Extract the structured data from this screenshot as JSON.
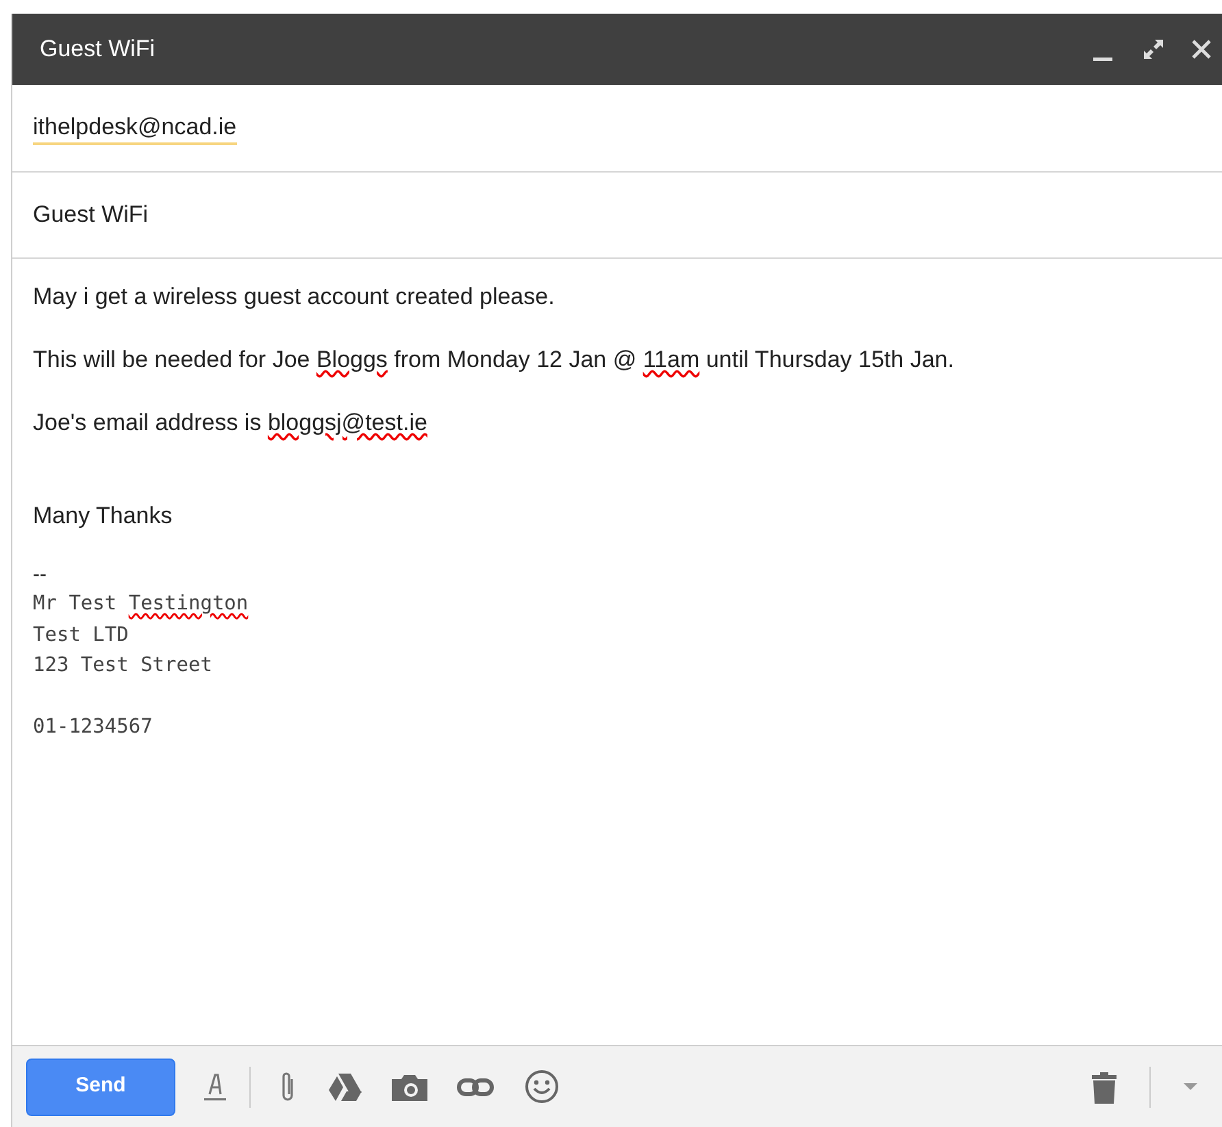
{
  "window": {
    "title": "Guest WiFi"
  },
  "to": {
    "recipient": "ithelpdesk@ncad.ie"
  },
  "subject": {
    "value": "Guest WiFi"
  },
  "body": {
    "paragraphs": [
      {
        "segments": [
          {
            "text": "May i get a wireless guest account created please.",
            "misspelled": false
          }
        ]
      },
      {
        "segments": [
          {
            "text": "This will be needed for Joe ",
            "misspelled": false
          },
          {
            "text": "Bloggs",
            "misspelled": true
          },
          {
            "text": " from Monday 12 Jan @ ",
            "misspelled": false
          },
          {
            "text": "11am",
            "misspelled": true
          },
          {
            "text": " until Thursday 15th Jan.",
            "misspelled": false
          }
        ]
      },
      {
        "segments": [
          {
            "text": "Joe's email address is ",
            "misspelled": false
          },
          {
            "text": "bloggsj@test.ie",
            "misspelled": true
          }
        ]
      }
    ],
    "closing": "Many Thanks"
  },
  "signature": {
    "separator": "--",
    "address_lines": [
      {
        "segments": [
          {
            "text": "Mr Test ",
            "misspelled": false
          },
          {
            "text": "Testington",
            "misspelled": true
          }
        ]
      },
      {
        "segments": [
          {
            "text": "Test LTD",
            "misspelled": false
          }
        ]
      },
      {
        "segments": [
          {
            "text": "123 Test Street",
            "misspelled": false
          }
        ]
      }
    ],
    "phone": "01-1234567"
  },
  "toolbar": {
    "send": "Send"
  }
}
